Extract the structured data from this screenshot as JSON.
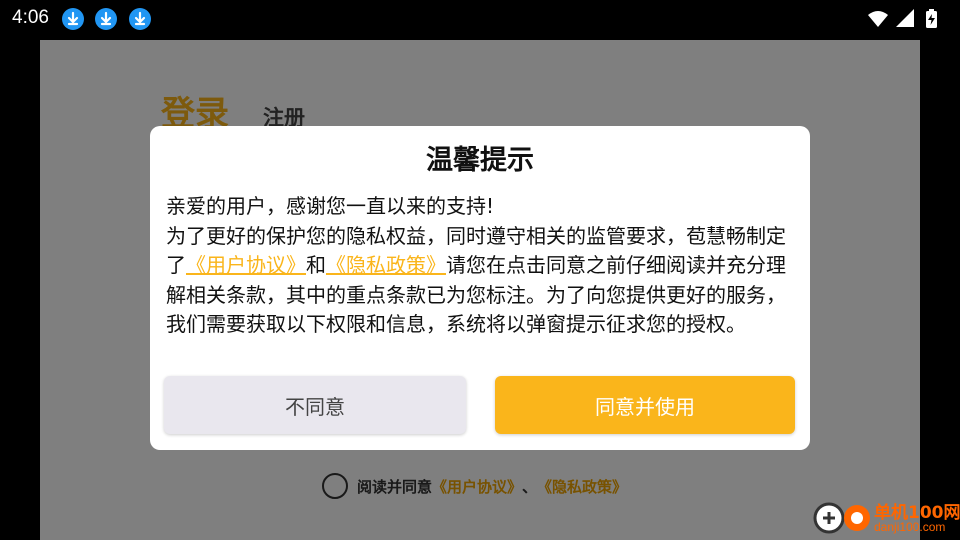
{
  "status_bar": {
    "time": "4:06",
    "notification_icons": [
      "download-icon",
      "download-icon",
      "download-icon"
    ],
    "system_icons": [
      "wifi-icon",
      "signal-icon",
      "battery-charging-icon"
    ]
  },
  "login_page": {
    "tab_login": "登录",
    "tab_register": "注册",
    "agree_prefix": "阅读并同意",
    "agree_user_agreement": "《用户协议》",
    "agree_separator": "、",
    "agree_privacy_policy": "《隐私政策》"
  },
  "dialog": {
    "title": "温馨提示",
    "line1": "亲爱的用户，感谢您一直以来的支持!",
    "para2_before": "为了更好的保护您的隐私权益，同时遵守相关的监管要求，苞慧畅制定了",
    "link_user_agreement": "《用户协议》",
    "para2_and": "和",
    "link_privacy_policy": "《隐私政策》",
    "para2_after": "请您在点击同意之前仔细阅读并充分理解相关条款，其中的重点条款已为您标注。为了向您提供更好的服务，我们需要获取以下权限和信息，系统将以弹窗提示征求您的授权。",
    "disagree_label": "不同意",
    "agree_label": "同意并使用"
  },
  "watermark": {
    "line1": "单机100网",
    "line2": "danji100.com"
  },
  "colors": {
    "accent": "#fab51b",
    "overlay": "rgba(0,0,0,0.5)",
    "download_icon": "#2196f3"
  }
}
